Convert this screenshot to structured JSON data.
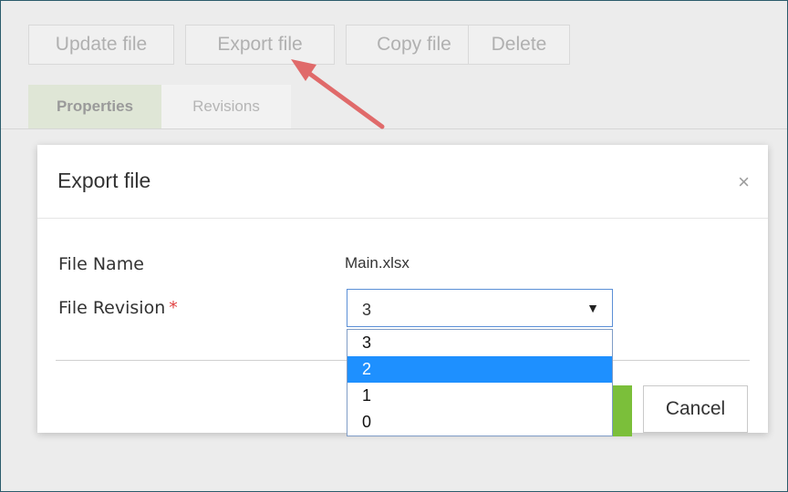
{
  "toolbar": {
    "update_label": "Update file",
    "export_label": "Export file",
    "copy_label": "Copy file",
    "delete_label": "Delete"
  },
  "tabs": [
    {
      "label": "Properties",
      "active": true
    },
    {
      "label": "Revisions",
      "active": false
    }
  ],
  "modal": {
    "title": "Export file",
    "close_symbol": "×",
    "file_name_label": "File Name",
    "file_name_value": "Main.xlsx",
    "file_revision_label": "File Revision",
    "required_marker": "*",
    "selected_revision": "3",
    "caret": "▼",
    "cancel_label": "Cancel",
    "revision_options": [
      "3",
      "2",
      "1",
      "0"
    ],
    "highlighted_option": "2"
  },
  "colors": {
    "accent_green": "#7bbf3a",
    "highlight_blue": "#1e90ff",
    "required_red": "#e04040",
    "annotation_arrow": "#e06a6a"
  }
}
